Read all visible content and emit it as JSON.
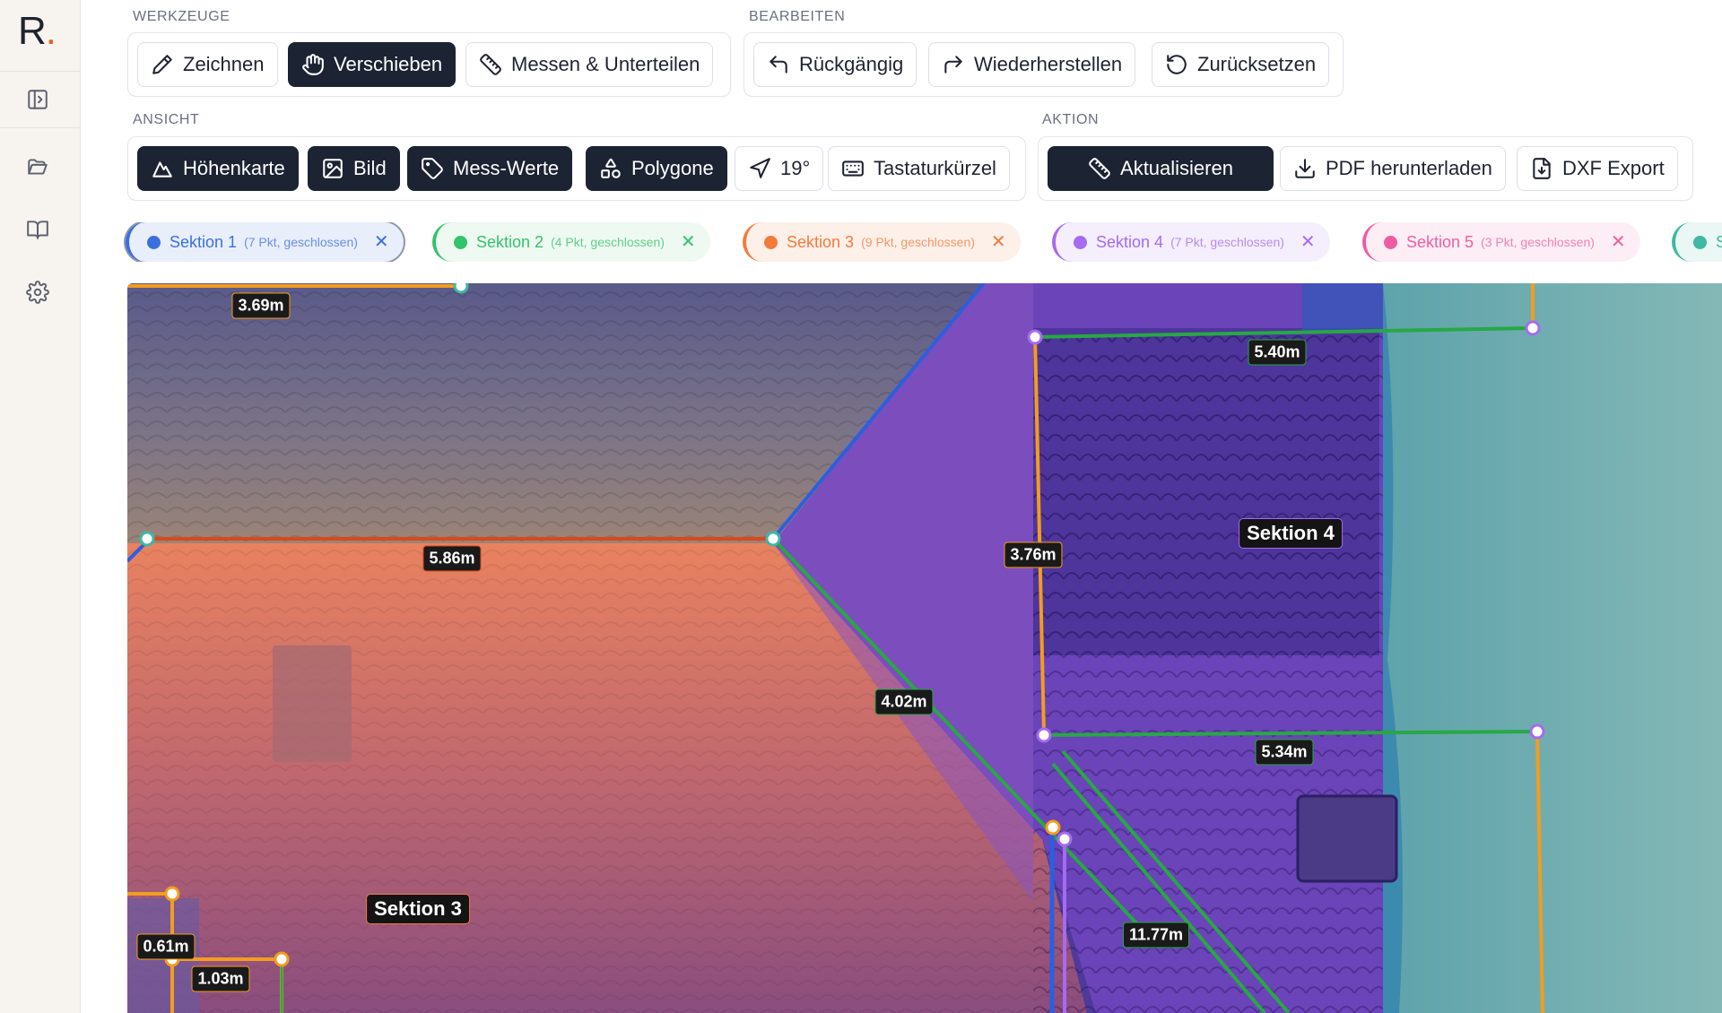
{
  "brand": {
    "letter": "R",
    "dot": "."
  },
  "rail": {
    "icons": [
      "sidebar-toggle-icon",
      "folder-icon",
      "book-icon",
      "gear-icon"
    ]
  },
  "toolbar": {
    "werkzeuge": {
      "label": "WERKZEUGE",
      "items": [
        {
          "label": "Zeichnen",
          "icon": "pencil-icon",
          "active": false
        },
        {
          "label": "Verschieben",
          "icon": "hand-icon",
          "active": true
        },
        {
          "label": "Messen & Unterteilen",
          "icon": "ruler-icon",
          "active": false
        }
      ]
    },
    "bearbeiten": {
      "label": "BEARBEITEN",
      "items": [
        {
          "label": "Rückgängig",
          "icon": "undo-icon"
        },
        {
          "label": "Wiederherstellen",
          "icon": "redo-icon"
        },
        {
          "label": "Zurücksetzen",
          "icon": "reset-icon"
        }
      ]
    },
    "ansicht": {
      "label": "ANSICHT",
      "items": [
        {
          "label": "Höhenkarte",
          "icon": "mountain-icon",
          "active": true
        },
        {
          "label": "Bild",
          "icon": "image-icon",
          "active": true
        },
        {
          "label": "Mess-Werte",
          "icon": "tag-icon",
          "active": true
        },
        {
          "label": "Polygone",
          "icon": "shapes-icon",
          "active": true
        },
        {
          "label": "19°",
          "icon": "compass-arrow-icon",
          "active": false
        },
        {
          "label": "Tastaturkürzel",
          "icon": "keyboard-icon",
          "active": false
        }
      ]
    },
    "aktion": {
      "label": "AKTION",
      "items": [
        {
          "label": "Aktualisieren",
          "icon": "ruler-icon",
          "active": true
        },
        {
          "label": "PDF herunterladen",
          "icon": "download-icon",
          "active": false
        },
        {
          "label": "DXF Export",
          "icon": "file-download-icon",
          "active": false
        }
      ]
    }
  },
  "sections": [
    {
      "name": "Sektion 1",
      "meta": "(7 Pkt, geschlossen)",
      "color": "#3b6fe0",
      "bg": "#eef2fc",
      "selected": true
    },
    {
      "name": "Sektion 2",
      "meta": "(4 Pkt, geschlossen)",
      "color": "#34c26b",
      "bg": "#edf9f1"
    },
    {
      "name": "Sektion 3",
      "meta": "(9 Pkt, geschlossen)",
      "color": "#f47a3c",
      "bg": "#fdf0e8"
    },
    {
      "name": "Sektion 4",
      "meta": "(7 Pkt, geschlossen)",
      "color": "#a56bf0",
      "bg": "#f4eefd"
    },
    {
      "name": "Sektion 5",
      "meta": "(3 Pkt, geschlossen)",
      "color": "#ee5da1",
      "bg": "#fdeef5"
    },
    {
      "name": "S",
      "meta": "",
      "color": "#3fb8a4",
      "bg": "#eaf7f4"
    }
  ],
  "close_glyph": "✕",
  "canvas": {
    "measurements": [
      "3.69m",
      "5.86m",
      "5.40m",
      "3.76m",
      "4.02m",
      "5.34m",
      "0.61m",
      "1.03m",
      "11.77m"
    ],
    "section_labels": [
      "Sektion 4",
      "Sektion 3"
    ]
  },
  "colors": {
    "orange": "#f39c1e",
    "green": "#27a844",
    "blue": "#2b5fe0",
    "redline": "#d9491c",
    "purple": "#a56bf0"
  }
}
